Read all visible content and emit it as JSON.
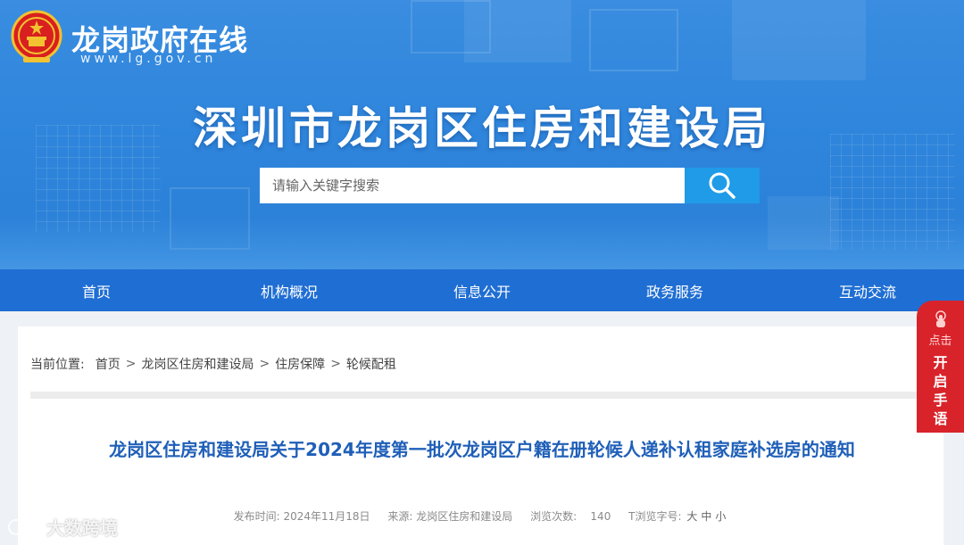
{
  "header": {
    "site_name": "龙岗政府在线",
    "site_url": "www.lg.gov.cn",
    "dept_title": "深圳市龙岗区住房和建设局",
    "emblem_icon": "national-emblem-icon",
    "search": {
      "placeholder": "请输入关键字搜索",
      "button_icon": "search-icon"
    }
  },
  "nav": {
    "items": [
      {
        "label": "首页"
      },
      {
        "label": "机构概况"
      },
      {
        "label": "信息公开"
      },
      {
        "label": "政务服务"
      },
      {
        "label": "互动交流"
      }
    ]
  },
  "breadcrumb": {
    "lead": "当前位置:",
    "items": [
      "首页",
      "龙岗区住房和建设局",
      "住房保障",
      "轮候配租"
    ],
    "separator": ">"
  },
  "article": {
    "title": "龙岗区住房和建设局关于2024年度第一批次龙岗区户籍在册轮候人递补认租家庭补选房的通知",
    "meta": {
      "publish_label": "发布时间:",
      "publish_date": "2024年11月18日",
      "source_label": "来源:",
      "source": "龙岗区住房和建设局",
      "views_label": "浏览次数:",
      "views": "140",
      "font_label": "T浏览字号:",
      "font_sizes": [
        "大",
        "中",
        "小"
      ]
    }
  },
  "sign_language": {
    "click": "点击",
    "label": "开启手语",
    "icon": "hand-pointer-icon"
  },
  "watermark": {
    "text": "大数跨境"
  },
  "colors": {
    "banner": "#2f86dc",
    "nav": "#1f6ed3",
    "search_button": "#1f9be8",
    "title": "#1f5fb8",
    "sign_tab": "#d8232a"
  }
}
